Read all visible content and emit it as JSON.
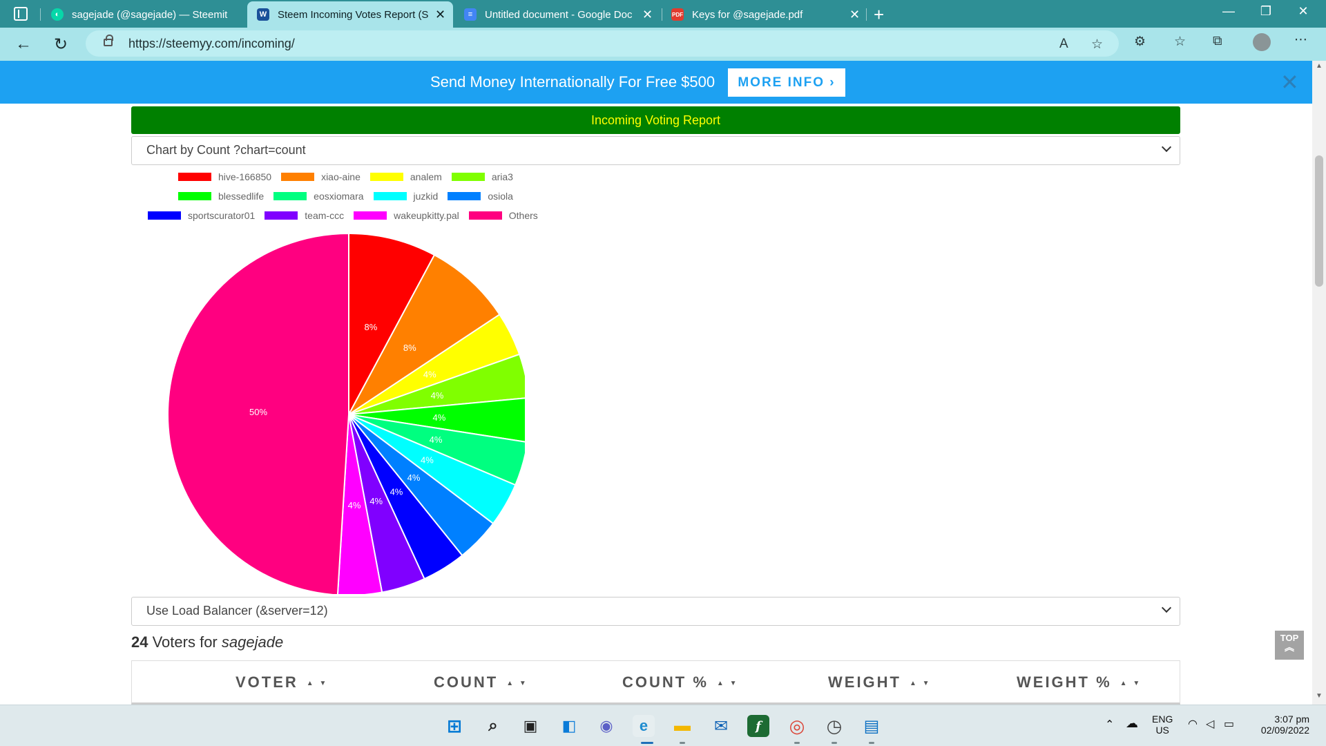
{
  "browser": {
    "tabs": [
      {
        "title": "sagejade (@sagejade) — Steemit",
        "active": false
      },
      {
        "title": "Steem Incoming Votes Report (S",
        "active": true
      },
      {
        "title": "Untitled document - Google Doc",
        "active": false
      },
      {
        "title": "Keys for @sagejade.pdf",
        "active": false
      }
    ],
    "url": "https://steemyy.com/incoming/"
  },
  "ad": {
    "text": "Send Money Internationally For Free $500",
    "button_label": "MORE INFO ›",
    "close": "✕"
  },
  "report": {
    "header": "Incoming Voting Report",
    "chart_select": "Chart by Count ?chart=count",
    "server_select": "Use Load Balancer (&server=12)",
    "voters_count": "24",
    "voters_label": " Voters for ",
    "voters_user": "sagejade"
  },
  "chart_data": {
    "type": "pie",
    "legend_position": "top-left",
    "slices": [
      {
        "label": "hive-166850",
        "value": 8,
        "color": "#ff0000"
      },
      {
        "label": "xiao-aine",
        "value": 8,
        "color": "#ff8000"
      },
      {
        "label": "analem",
        "value": 4,
        "color": "#ffff00"
      },
      {
        "label": "aria3",
        "value": 4,
        "color": "#80ff00"
      },
      {
        "label": "blessedlife",
        "value": 4,
        "color": "#00ff00"
      },
      {
        "label": "eosxiomara",
        "value": 4,
        "color": "#00ff80"
      },
      {
        "label": "juzkid",
        "value": 4,
        "color": "#00ffff"
      },
      {
        "label": "osiola",
        "value": 4,
        "color": "#0080ff"
      },
      {
        "label": "sportscurator01",
        "value": 4,
        "color": "#0000ff"
      },
      {
        "label": "team-ccc",
        "value": 4,
        "color": "#8000ff"
      },
      {
        "label": "wakeupkitty.pal",
        "value": 4,
        "color": "#ff00ff"
      },
      {
        "label": "Others",
        "value": 50,
        "color": "#ff0080"
      }
    ],
    "value_suffix": "%"
  },
  "table": {
    "columns": [
      "VOTER",
      "COUNT",
      "COUNT %",
      "WEIGHT",
      "WEIGHT %"
    ],
    "sort_glyph": "▲ ▼"
  },
  "top_button": "TOP",
  "taskbar": {
    "lang_line1": "ENG",
    "lang_line2": "US",
    "time": "3:07 pm",
    "date": "02/09/2022"
  }
}
